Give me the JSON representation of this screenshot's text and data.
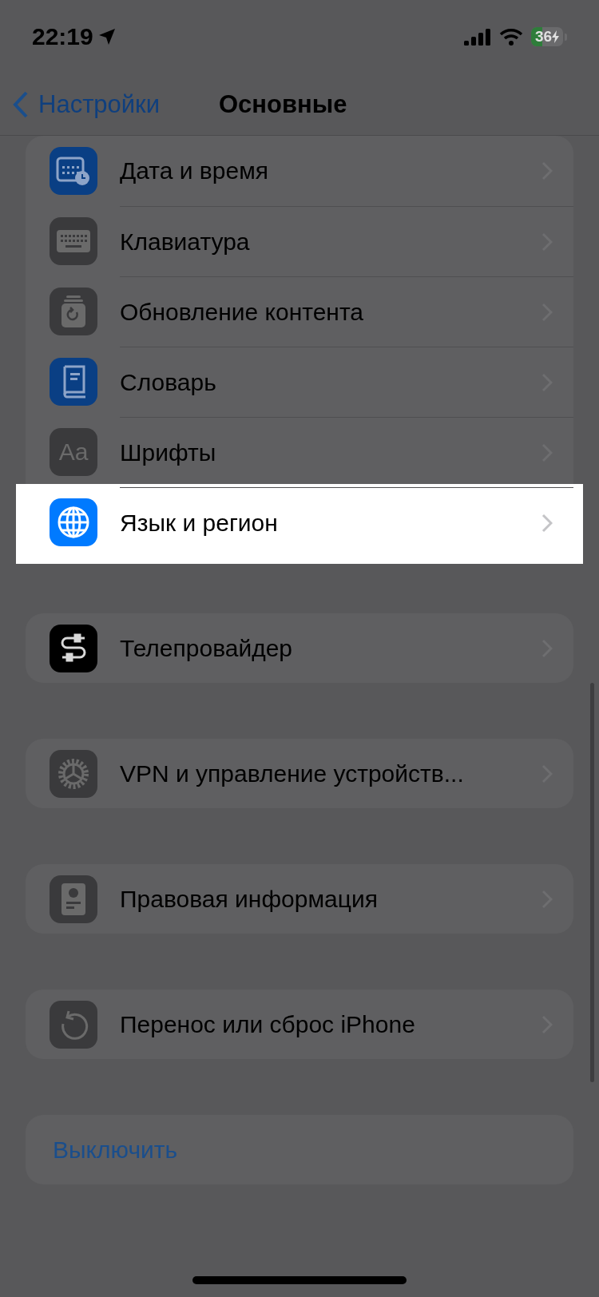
{
  "status_bar": {
    "time": "22:19",
    "battery": {
      "text": "36",
      "level": 0.36,
      "charging": true
    }
  },
  "nav": {
    "back": "Настройки",
    "title": "Основные"
  },
  "groups": [
    {
      "rows": [
        {
          "kind": "calendar",
          "label": "Дата и время",
          "highlighted": false
        },
        {
          "kind": "keyboard",
          "label": "Клавиатура",
          "highlighted": false
        },
        {
          "kind": "refresh",
          "label": "Обновление контента",
          "highlighted": false
        },
        {
          "kind": "book",
          "label": "Словарь",
          "highlighted": false
        },
        {
          "kind": "text",
          "icon_text": "Aa",
          "label": "Шрифты",
          "highlighted": false
        },
        {
          "kind": "globe",
          "label": "Язык и регион",
          "highlighted": true
        }
      ]
    },
    {
      "rows": [
        {
          "kind": "cable",
          "label": "Телепровайдер",
          "highlighted": false
        }
      ]
    },
    {
      "rows": [
        {
          "kind": "gear",
          "label": "VPN и управление устройств...",
          "highlighted": false
        }
      ]
    },
    {
      "rows": [
        {
          "kind": "document",
          "label": "Правовая информация",
          "highlighted": false
        }
      ]
    },
    {
      "rows": [
        {
          "kind": "reset",
          "label": "Перенос или сброс iPhone",
          "highlighted": false
        }
      ]
    },
    {
      "rows": [
        {
          "kind": "action",
          "label": "Выключить",
          "highlighted": false
        }
      ]
    }
  ]
}
